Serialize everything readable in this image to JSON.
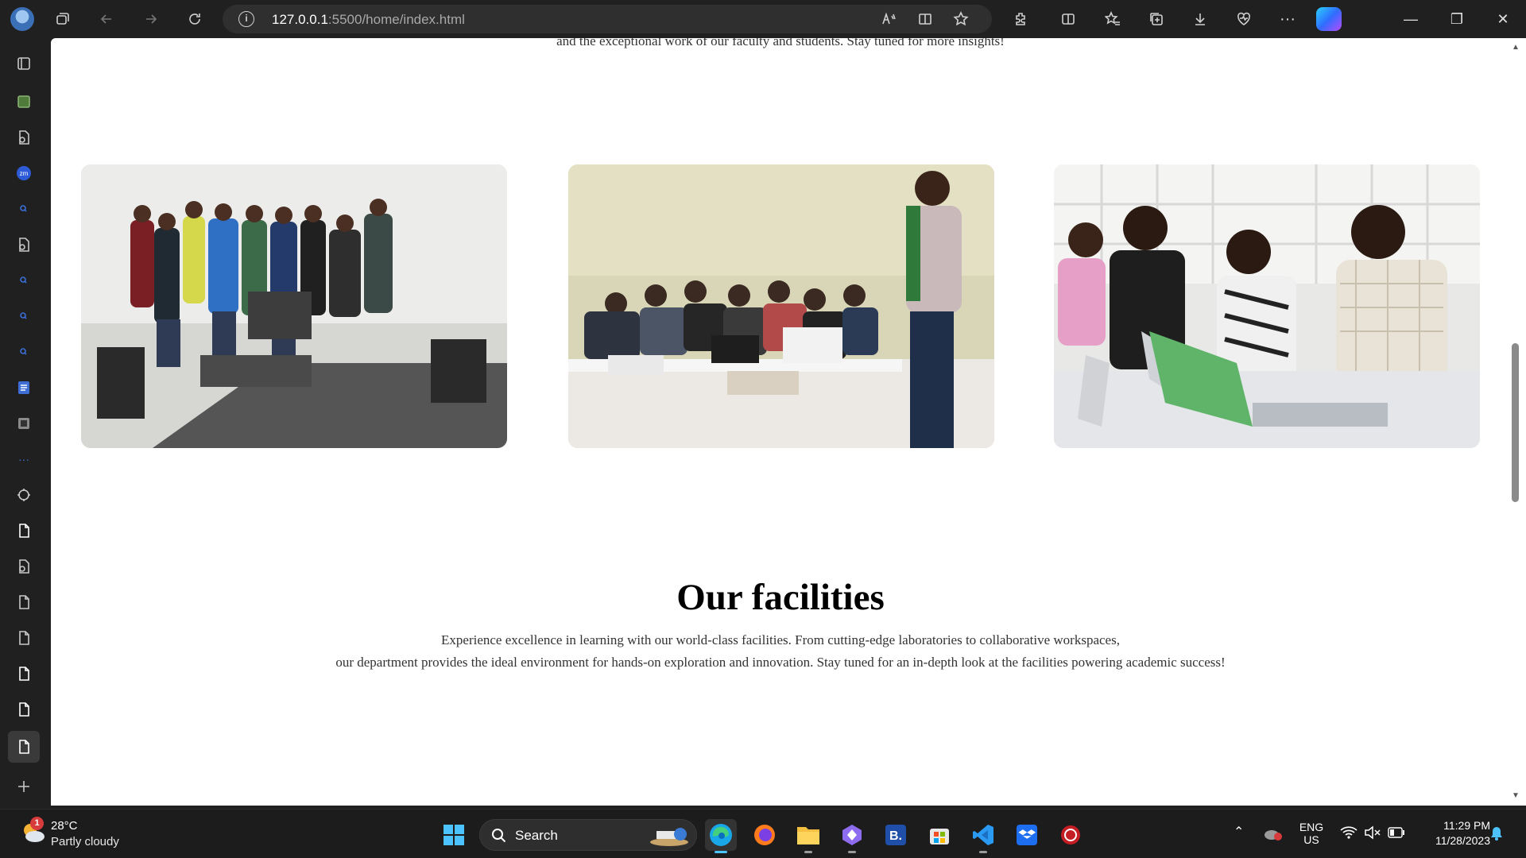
{
  "browser": {
    "url_host": "127.0.0.1",
    "url_rest": ":5500/home/index.html"
  },
  "page": {
    "intro_tail": "and the exceptional work of our faculty and students. Stay tuned for more insights!",
    "facilities": {
      "title": "Our facilities",
      "desc_line1": "Experience excellence in learning with our world-class facilities. From cutting-edge laboratories to collaborative workspaces,",
      "desc_line2": "our department provides the ideal environment for hands-on exploration and innovation. Stay tuned for an in-depth look at the facilities powering academic success!"
    },
    "photos": [
      {
        "name": "group-photo"
      },
      {
        "name": "lecture-photo"
      },
      {
        "name": "lab-students-photo"
      }
    ]
  },
  "taskbar": {
    "weather_badge": "1",
    "weather_temp": "28°C",
    "weather_desc": "Partly cloudy",
    "search_label": "Search",
    "lang": "ENG",
    "region": "US",
    "time": "11:29 PM",
    "date": "11/28/2023"
  }
}
